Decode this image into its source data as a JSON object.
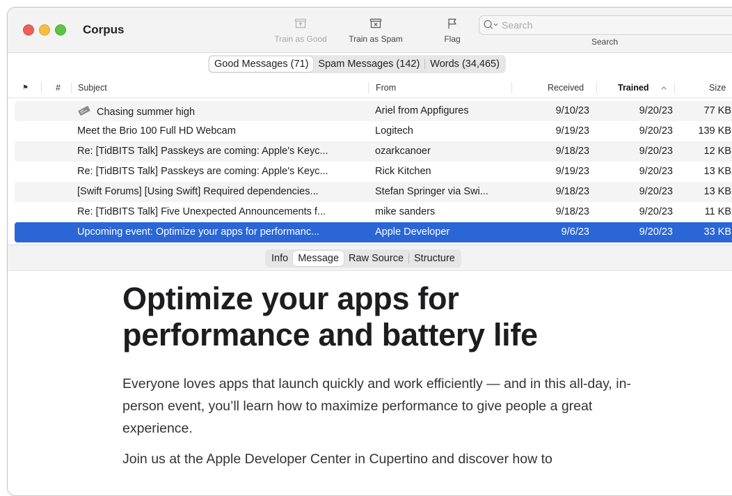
{
  "window": {
    "title": "Corpus"
  },
  "toolbar": {
    "train_good_label": "Train as Good",
    "train_spam_label": "Train as Spam",
    "flag_label": "Flag",
    "search_placeholder": "Search",
    "search_label": "Search"
  },
  "top_tabs": {
    "good": "Good Messages (71)",
    "spam": "Spam Messages (142)",
    "words": "Words (34,465)",
    "selected": "good"
  },
  "table": {
    "columns": {
      "flag": "⚑",
      "number": "#",
      "subject": "Subject",
      "from": "From",
      "received": "Received",
      "trained": "Trained",
      "size": "Size"
    },
    "sort_column": "trained",
    "sort_indicator": "^",
    "rows": [
      {
        "subject": "Chasing summer high",
        "from": "Ariel from Appfigures",
        "received": "9/10/23",
        "trained": "9/20/23",
        "size": "77 KB",
        "icon": "newspaper-icon"
      },
      {
        "subject": "Meet the Brio 100 Full HD Webcam",
        "from": "Logitech",
        "received": "9/19/23",
        "trained": "9/20/23",
        "size": "139 KB"
      },
      {
        "subject": "Re: [TidBITS Talk] Passkeys are coming: Apple's Keyc...",
        "from": "ozarkcanoer",
        "received": "9/18/23",
        "trained": "9/20/23",
        "size": "12 KB"
      },
      {
        "subject": "Re: [TidBITS Talk] Passkeys are coming: Apple's Keyc...",
        "from": "Rick Kitchen",
        "received": "9/19/23",
        "trained": "9/20/23",
        "size": "13 KB"
      },
      {
        "subject": "[Swift Forums] [Using Swift] Required dependencies...",
        "from": "Stefan Springer via Swi...",
        "received": "9/18/23",
        "trained": "9/20/23",
        "size": "13 KB"
      },
      {
        "subject": "Re: [TidBITS Talk] Five Unexpected Announcements f...",
        "from": "mike sanders",
        "received": "9/18/23",
        "trained": "9/20/23",
        "size": "11 KB"
      },
      {
        "subject": "Upcoming event: Optimize your apps for performanc...",
        "from": "Apple Developer",
        "received": "9/6/23",
        "trained": "9/20/23",
        "size": "33 KB",
        "selected": true
      }
    ]
  },
  "detail_tabs": {
    "info": "Info",
    "message": "Message",
    "raw": "Raw Source",
    "structure": "Structure",
    "selected": "message"
  },
  "message": {
    "headline": "Optimize your apps for performance and battery life",
    "para1": "Everyone loves apps that launch quickly and work efficiently — and in this all-day, in-person event, you’ll learn how to maximize performance to give people a great experience.",
    "para2": "Join us at the Apple Developer Center in Cupertino and discover how to"
  },
  "colors": {
    "selection": "#2b66d6",
    "close": "#ee5f58",
    "minimize": "#f6be3c",
    "zoom": "#5cc544"
  }
}
